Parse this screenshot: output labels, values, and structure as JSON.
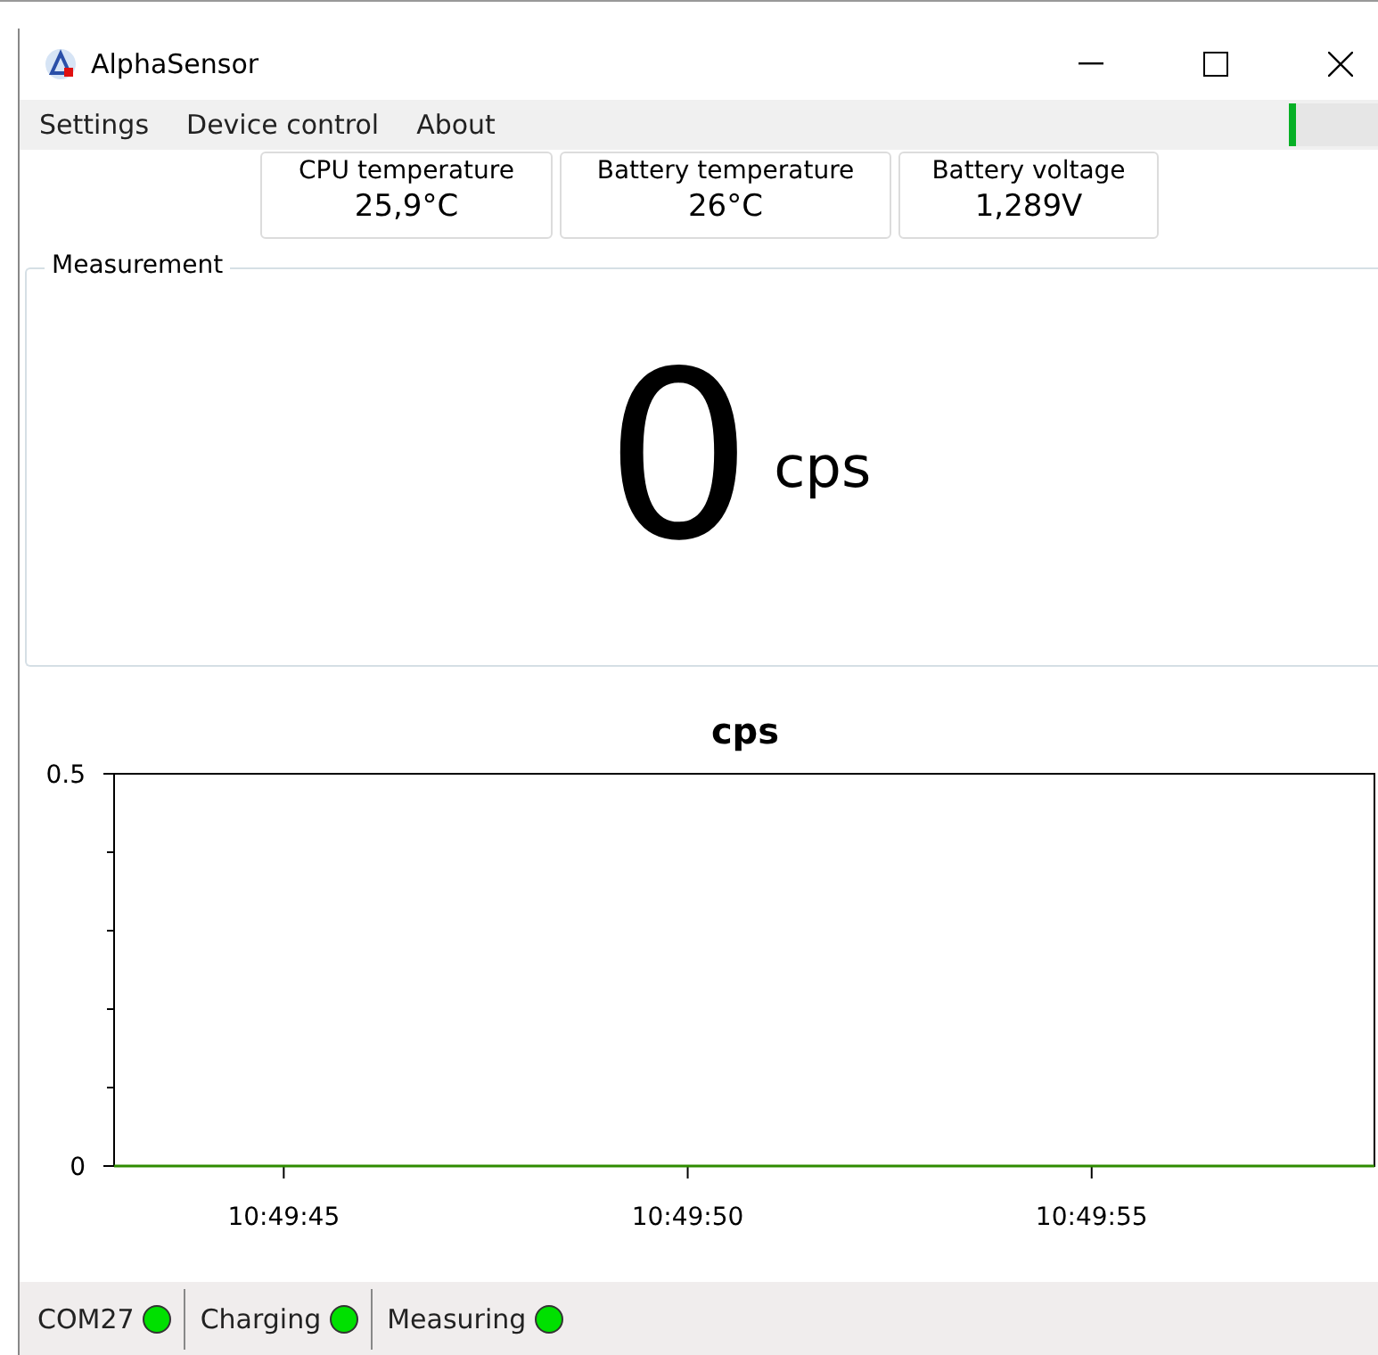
{
  "window": {
    "title": "AlphaSensor"
  },
  "menu": [
    {
      "label": "Settings"
    },
    {
      "label": "Device control"
    },
    {
      "label": "About"
    }
  ],
  "progress": {
    "level": 0.08
  },
  "readings": [
    {
      "label": "CPU temperature",
      "value": "25,9°C"
    },
    {
      "label": "Battery temperature",
      "value": "26°C"
    },
    {
      "label": "Battery voltage",
      "value": "1,289V"
    }
  ],
  "measurement": {
    "title": "Measurement",
    "value": "0",
    "unit": "cps"
  },
  "chart": {
    "chart_data": {
      "type": "line",
      "title": "cps",
      "x": [
        38982.9,
        38998.5
      ],
      "series": [
        {
          "color": "#2e8b00",
          "values": [
            0,
            0
          ]
        }
      ],
      "xlim": [
        38982.9,
        38998.5
      ],
      "ylim": [
        0,
        0.5
      ],
      "xticks": [
        {
          "value": 38985,
          "label": "10:49:45"
        },
        {
          "value": 38990,
          "label": "10:49:50"
        },
        {
          "value": 38995,
          "label": "10:49:55"
        }
      ],
      "yticks": [
        {
          "value": 0,
          "label": "0"
        },
        {
          "value": 0.5,
          "label": "0.5"
        }
      ]
    }
  },
  "status_bar": [
    {
      "label": "COM27",
      "on": true
    },
    {
      "label": "Charging",
      "on": true
    },
    {
      "label": "Measuring",
      "on": true
    }
  ]
}
